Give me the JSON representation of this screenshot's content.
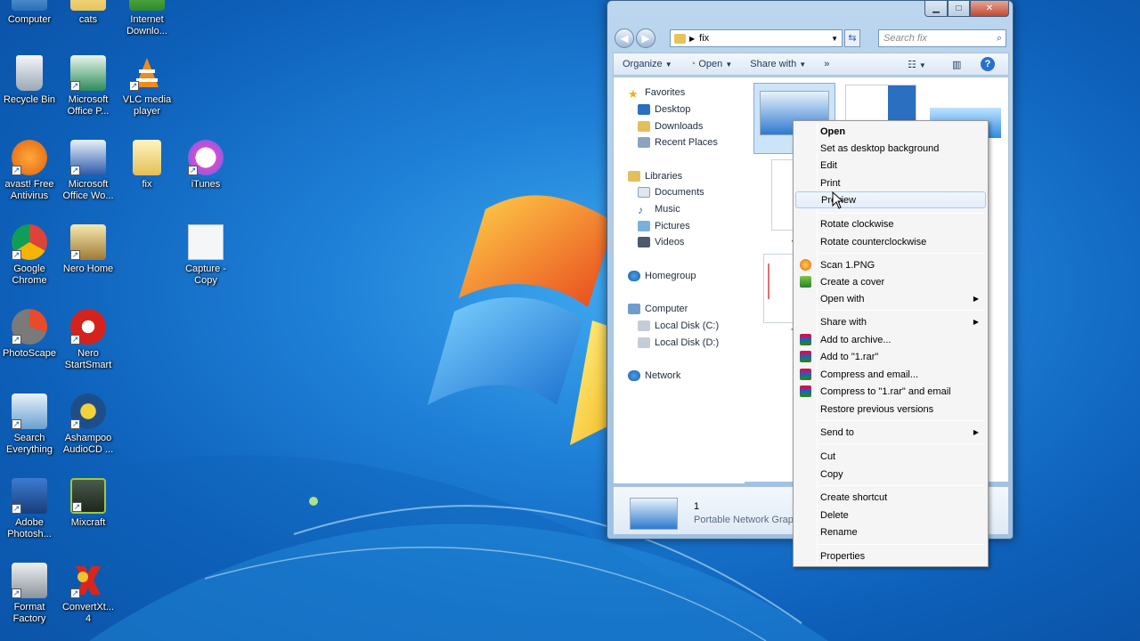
{
  "desktop": {
    "icons": [
      {
        "label": "Computer",
        "icon": "computer-icon"
      },
      {
        "label": "cats",
        "icon": "folder-icon"
      },
      {
        "label": "Internet Downlo...",
        "icon": "internet-download-manager-icon"
      },
      {
        "label": "Recycle Bin",
        "icon": "recycle-bin-icon"
      },
      {
        "label": "Microsoft Office P...",
        "icon": "office-publisher-icon"
      },
      {
        "label": "VLC media player",
        "icon": "vlc-icon"
      },
      {
        "label": "avast! Free Antivirus",
        "icon": "avast-icon"
      },
      {
        "label": "Microsoft Office Wo...",
        "icon": "word-icon"
      },
      {
        "label": "fix",
        "icon": "folder-icon"
      },
      {
        "label": "iTunes",
        "icon": "itunes-icon"
      },
      {
        "label": "Google Chrome",
        "icon": "chrome-icon"
      },
      {
        "label": "Nero Home",
        "icon": "nero-home-icon"
      },
      {
        "label": "Capture - Copy",
        "icon": "image-file-icon"
      },
      {
        "label": "PhotoScape",
        "icon": "photoscape-icon"
      },
      {
        "label": "Nero StartSmart",
        "icon": "nero-startsmart-icon"
      },
      {
        "label": "Search Everything",
        "icon": "search-everything-icon"
      },
      {
        "label": "Ashampoo AudioCD ...",
        "icon": "ashampoo-icon"
      },
      {
        "label": "Adobe Photosh...",
        "icon": "photoshop-icon"
      },
      {
        "label": "Mixcraft",
        "icon": "mixcraft-icon"
      },
      {
        "label": "Format Factory",
        "icon": "format-factory-icon"
      },
      {
        "label": "ConvertXt... 4",
        "icon": "convertx-icon"
      }
    ]
  },
  "explorer": {
    "address": "fix",
    "search_placeholder": "Search fix",
    "toolbar": {
      "organize": "Organize",
      "open": "Open",
      "share_with": "Share with",
      "more": "»"
    },
    "nav": {
      "favorites": "Favorites",
      "desktop": "Desktop",
      "downloads": "Downloads",
      "recent": "Recent Places",
      "libraries": "Libraries",
      "documents": "Documents",
      "music": "Music",
      "pictures": "Pictures",
      "videos": "Videos",
      "homegroup": "Homegroup",
      "computer": "Computer",
      "disk_c": "Local Disk (C:)",
      "disk_d": "Local Disk (D:)",
      "network": "Network"
    },
    "thumb_labels": {
      "t1": "1",
      "t4": "4",
      "t7": "7"
    },
    "details": {
      "name": "1",
      "type": "Portable Network Graph"
    }
  },
  "context_menu": {
    "open": "Open",
    "set_bg": "Set as desktop background",
    "edit": "Edit",
    "print": "Print",
    "preview": "Preview",
    "rotate_cw": "Rotate clockwise",
    "rotate_ccw": "Rotate counterclockwise",
    "scan": "Scan 1.PNG",
    "create_cover": "Create a cover",
    "open_with": "Open with",
    "share_with": "Share with",
    "add_archive": "Add to archive...",
    "add_rar": "Add to \"1.rar\"",
    "compress_email": "Compress and email...",
    "compress_rar_email": "Compress to \"1.rar\" and email",
    "restore": "Restore previous versions",
    "send_to": "Send to",
    "cut": "Cut",
    "copy": "Copy",
    "create_shortcut": "Create shortcut",
    "delete": "Delete",
    "rename": "Rename",
    "properties": "Properties"
  }
}
